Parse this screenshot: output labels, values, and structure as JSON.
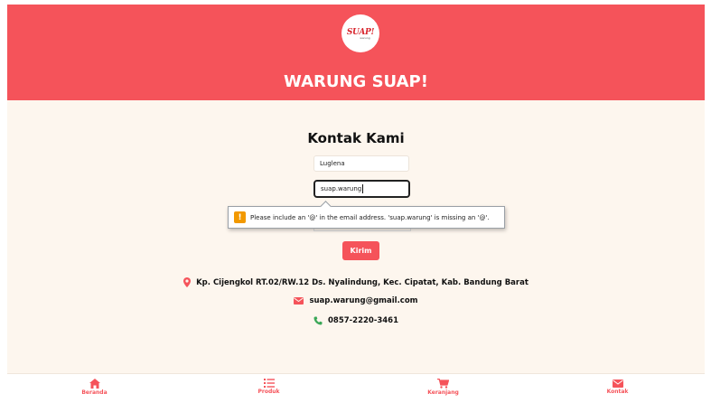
{
  "header": {
    "logo_text": "SUAP!",
    "logo_sub": "warung",
    "shop_title": "WARUNG SUAP!"
  },
  "main": {
    "title": "Kontak Kami",
    "name_value": "Luglena",
    "email_value": "suap.warung",
    "validation_message": "Please include an '@' in the email address. 'suap.warung' is missing an '@'.",
    "submit_label": "Kirim"
  },
  "contact": {
    "address": "Kp. Cijengkol RT.02/RW.12 Ds. Nyalindung, Kec. Cipatat, Kab. Bandung Barat",
    "email": "suap.warung@gmail.com",
    "phone": "0857-2220-3461"
  },
  "nav": {
    "items": [
      {
        "label": "Beranda",
        "icon": "home-icon"
      },
      {
        "label": "Produk",
        "icon": "list-icon"
      },
      {
        "label": "Keranjang",
        "icon": "cart-icon"
      },
      {
        "label": "Kontak",
        "icon": "mail-icon"
      }
    ]
  },
  "colors": {
    "brand": "#f5535a",
    "background": "#fdf6ee",
    "phone_icon": "#3aa757",
    "warning": "#f29900"
  }
}
